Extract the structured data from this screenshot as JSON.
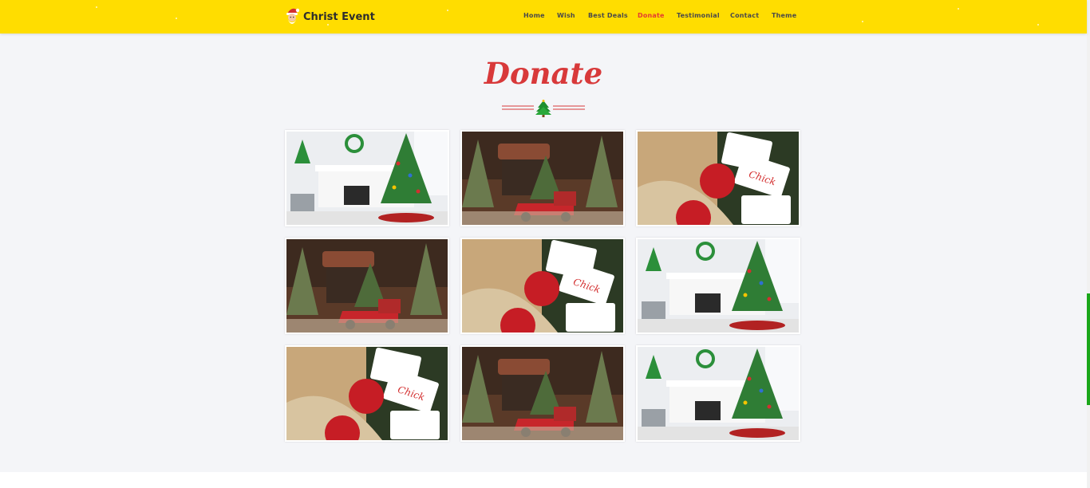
{
  "brand": {
    "name": "Christ Event",
    "logo_icon": "santa-icon"
  },
  "nav": {
    "items": [
      {
        "label": "Home",
        "active": false
      },
      {
        "label": "Wish",
        "active": false
      },
      {
        "label": "Best Deals",
        "active": false
      },
      {
        "label": "Donate",
        "active": true
      },
      {
        "label": "Testimonial",
        "active": false
      },
      {
        "label": "Contact",
        "active": false
      },
      {
        "label": "Theme",
        "active": false
      }
    ]
  },
  "colors": {
    "header_bg": "#ffdd00",
    "accent": "#e43b31",
    "title": "#d8393a",
    "section_bg": "#f4f5f8",
    "scrollbar": "#1aa71a"
  },
  "donate": {
    "title": "Donate",
    "divider_icon": "christmas-tree-icon",
    "gallery": [
      {
        "image": "fireplace-living-room"
      },
      {
        "image": "red-truck-christmas-tree"
      },
      {
        "image": "gift-cards-ornaments"
      },
      {
        "image": "red-truck-christmas-tree"
      },
      {
        "image": "gift-cards-ornaments"
      },
      {
        "image": "fireplace-living-room"
      },
      {
        "image": "gift-cards-ornaments"
      },
      {
        "image": "red-truck-christmas-tree"
      },
      {
        "image": "fireplace-living-room"
      }
    ]
  }
}
